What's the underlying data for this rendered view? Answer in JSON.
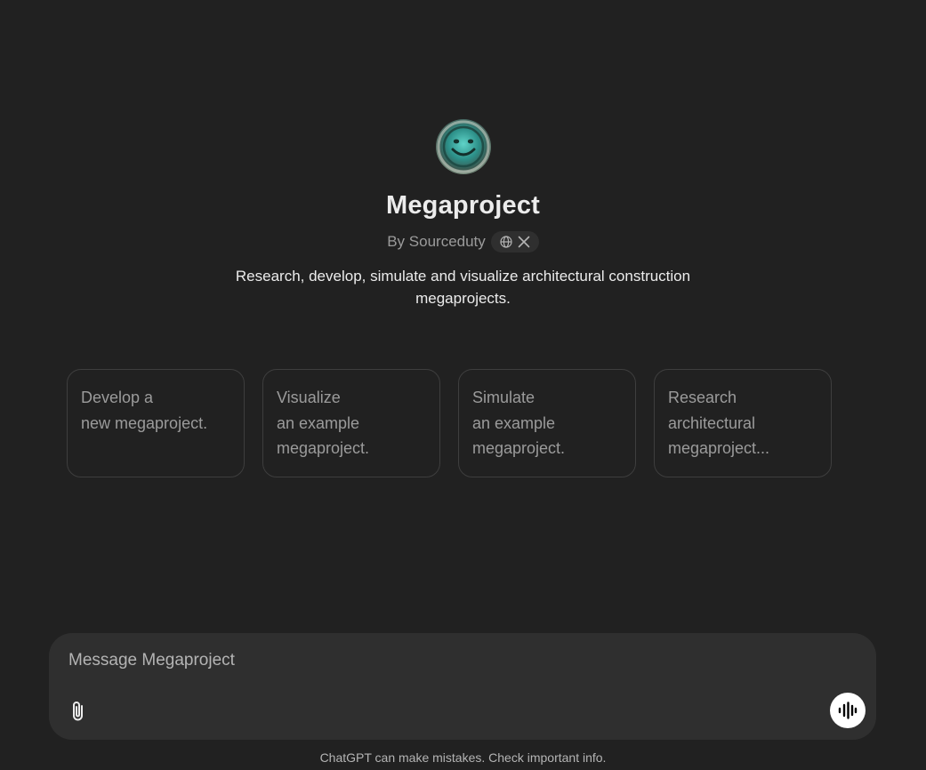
{
  "gpt": {
    "name": "Megaproject",
    "byline": "By Sourceduty",
    "description": "Research, develop, simulate and visualize architectural construction megaprojects.",
    "avatar_icon": "smiley-face-avatar",
    "social_icons": [
      "globe-icon",
      "x-icon"
    ]
  },
  "starters": [
    {
      "lines": [
        "Develop a",
        "new megaproject."
      ]
    },
    {
      "lines": [
        "Visualize",
        "an example",
        "megaproject."
      ]
    },
    {
      "lines": [
        "Simulate",
        "an example",
        "megaproject."
      ]
    },
    {
      "lines": [
        "Research",
        "architectural",
        "megaproject..."
      ]
    }
  ],
  "composer": {
    "placeholder": "Message Megaproject",
    "attach_icon": "paperclip-icon",
    "voice_icon": "voice-mode-icon"
  },
  "footer": {
    "disclaimer": "ChatGPT can make mistakes. Check important info."
  },
  "colors": {
    "background": "#212121",
    "composer": "#2f2f2f",
    "text": "#ececec",
    "muted": "#9b9b9b",
    "border": "#3e3e3e"
  }
}
